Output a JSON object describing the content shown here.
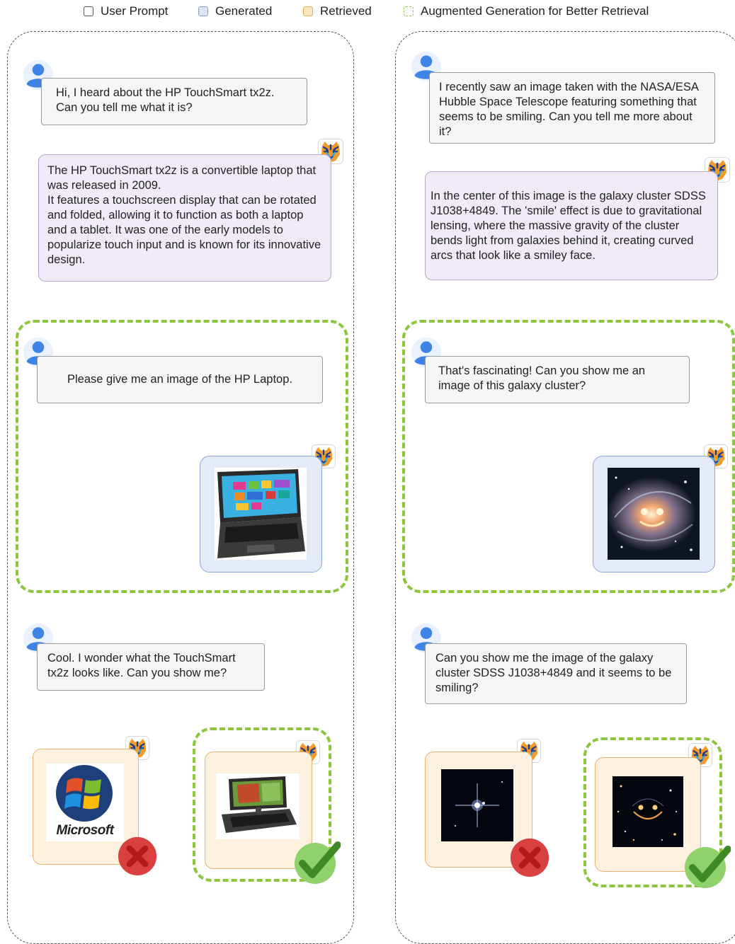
{
  "legend": {
    "user_prompt": "User Prompt",
    "generated": "Generated",
    "retrieved": "Retrieved",
    "augmented": "Augmented Generation for Better Retrieval"
  },
  "left": {
    "q1": "Hi, I heard about the HP TouchSmart tx2z.\nCan you tell me what it is?",
    "a1": "The HP TouchSmart tx2z is a convertible laptop that was released in 2009.\nIt features a touchscreen display that can be rotated and folded, allowing it to function as both a laptop and a tablet. It was one of the early models to popularize touch input and is known for its innovative design.",
    "q2": "Please give me an image of the HP Laptop.",
    "q3": "Cool. I wonder what the TouchSmart\ntx2z looks like. Can you show me?",
    "logo_text": "Microsoft"
  },
  "right": {
    "q1": "I recently saw an image taken with the NASA/ESA Hubble Space Telescope featuring something that seems to be smiling. Can you tell me more about it?",
    "a1": "In the center of this image is the galaxy cluster SDSS J1038+4849. The 'smile' effect is due to gravitational lensing, where the massive gravity of the cluster bends light from galaxies behind it, creating curved arcs that look like a smiley face.",
    "q2": "That's fascinating! Can you show me an\nimage of this galaxy cluster?",
    "q3": "Can you show me the image of the galaxy cluster SDSS J1038+4849 and it seems to be smiling?"
  },
  "colors": {
    "generated": "#dbe5f7",
    "retrieved": "#fde6c4",
    "augmented": "#8cc63f",
    "user_avatar": "#3d84e6",
    "wrong": "#d94040",
    "correct": "#8fd16a"
  },
  "icons": [
    "user-avatar-icon",
    "tiger-bot-icon",
    "cross-icon",
    "check-icon"
  ]
}
